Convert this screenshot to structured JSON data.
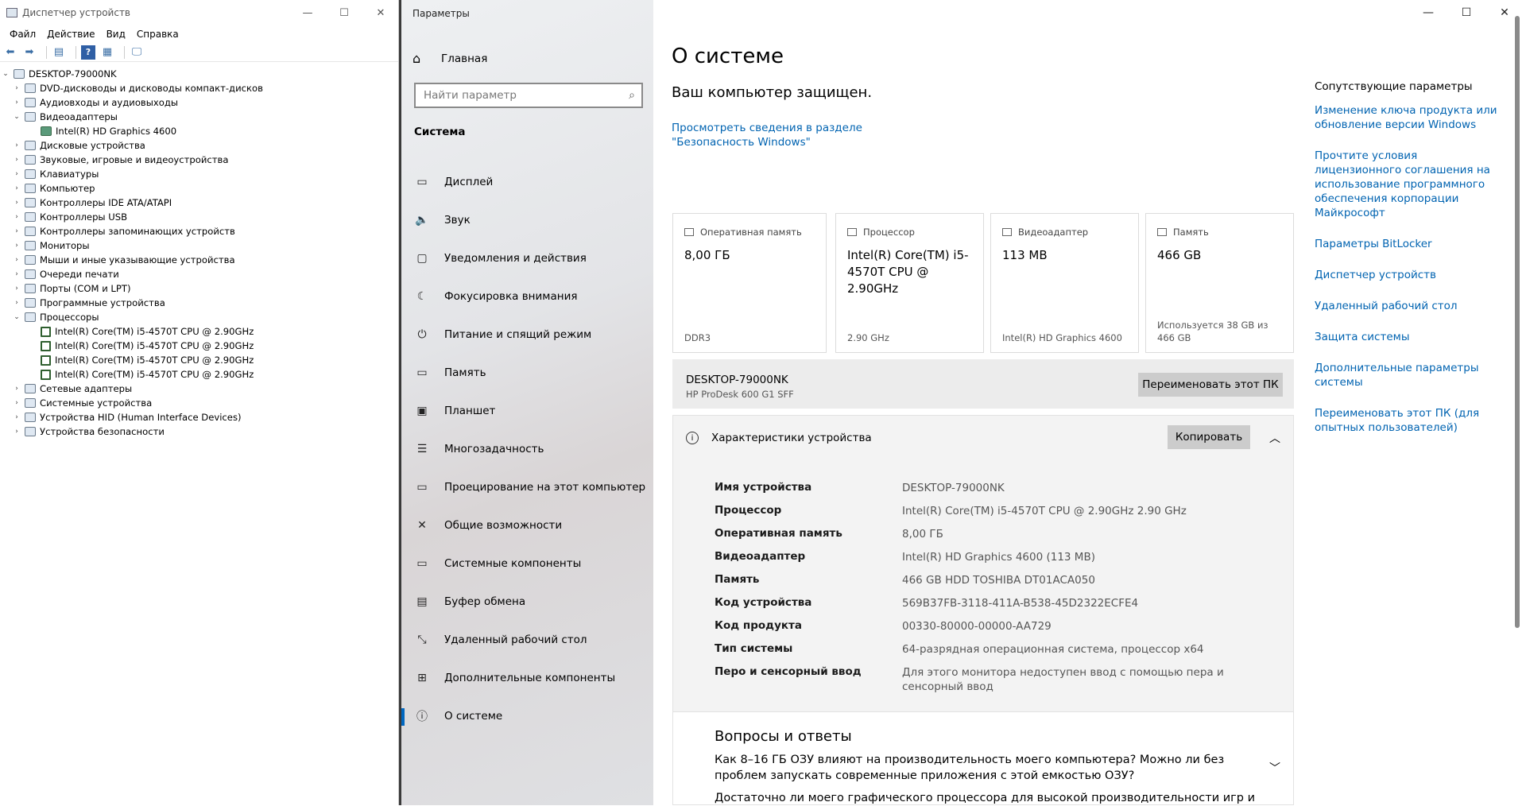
{
  "device_manager": {
    "title": "Диспетчер устройств",
    "menu": [
      "Файл",
      "Действие",
      "Вид",
      "Справка"
    ],
    "root": "DESKTOP-79000NK",
    "tree": [
      {
        "label": "DVD-дисководы и дисководы компакт-дисков",
        "level": 1,
        "expanded": false
      },
      {
        "label": "Аудиовходы и аудиовыходы",
        "level": 1,
        "expanded": false
      },
      {
        "label": "Видеоадаптеры",
        "level": 1,
        "expanded": true
      },
      {
        "label": "Intel(R) HD Graphics 4600",
        "level": 2,
        "icon": "gpu"
      },
      {
        "label": "Дисковые устройства",
        "level": 1,
        "expanded": false
      },
      {
        "label": "Звуковые, игровые и видеоустройства",
        "level": 1,
        "expanded": false
      },
      {
        "label": "Клавиатуры",
        "level": 1,
        "expanded": false
      },
      {
        "label": "Компьютер",
        "level": 1,
        "expanded": false
      },
      {
        "label": "Контроллеры IDE ATA/ATAPI",
        "level": 1,
        "expanded": false
      },
      {
        "label": "Контроллеры USB",
        "level": 1,
        "expanded": false
      },
      {
        "label": "Контроллеры запоминающих устройств",
        "level": 1,
        "expanded": false
      },
      {
        "label": "Мониторы",
        "level": 1,
        "expanded": false
      },
      {
        "label": "Мыши и иные указывающие устройства",
        "level": 1,
        "expanded": false
      },
      {
        "label": "Очереди печати",
        "level": 1,
        "expanded": false
      },
      {
        "label": "Порты (COM и LPT)",
        "level": 1,
        "expanded": false
      },
      {
        "label": "Программные устройства",
        "level": 1,
        "expanded": false
      },
      {
        "label": "Процессоры",
        "level": 1,
        "expanded": true
      },
      {
        "label": "Intel(R) Core(TM) i5-4570T CPU @ 2.90GHz",
        "level": 2,
        "icon": "cpu"
      },
      {
        "label": "Intel(R) Core(TM) i5-4570T CPU @ 2.90GHz",
        "level": 2,
        "icon": "cpu"
      },
      {
        "label": "Intel(R) Core(TM) i5-4570T CPU @ 2.90GHz",
        "level": 2,
        "icon": "cpu"
      },
      {
        "label": "Intel(R) Core(TM) i5-4570T CPU @ 2.90GHz",
        "level": 2,
        "icon": "cpu"
      },
      {
        "label": "Сетевые адаптеры",
        "level": 1,
        "expanded": false
      },
      {
        "label": "Системные устройства",
        "level": 1,
        "expanded": false
      },
      {
        "label": "Устройства HID (Human Interface Devices)",
        "level": 1,
        "expanded": false
      },
      {
        "label": "Устройства безопасности",
        "level": 1,
        "expanded": false
      }
    ]
  },
  "settings": {
    "app_title": "Параметры",
    "home": "Главная",
    "search_placeholder": "Найти параметр",
    "section": "Система",
    "nav": [
      {
        "label": "Дисплей",
        "icon": "display-icon",
        "glyph": "▭"
      },
      {
        "label": "Звук",
        "icon": "speaker-icon",
        "glyph": "🔈"
      },
      {
        "label": "Уведомления и действия",
        "icon": "notification-icon",
        "glyph": "▢"
      },
      {
        "label": "Фокусировка внимания",
        "icon": "moon-icon",
        "glyph": "☾"
      },
      {
        "label": "Питание и спящий режим",
        "icon": "power-icon",
        "glyph": "⏻"
      },
      {
        "label": "Память",
        "icon": "storage-icon",
        "glyph": "▭"
      },
      {
        "label": "Планшет",
        "icon": "tablet-icon",
        "glyph": "▣"
      },
      {
        "label": "Многозадачность",
        "icon": "multitask-icon",
        "glyph": "☰"
      },
      {
        "label": "Проецирование на этот компьютер",
        "icon": "project-icon",
        "glyph": "▭"
      },
      {
        "label": "Общие возможности",
        "icon": "share-icon",
        "glyph": "✕"
      },
      {
        "label": "Системные компоненты",
        "icon": "components-icon",
        "glyph": "▭"
      },
      {
        "label": "Буфер обмена",
        "icon": "clipboard-icon",
        "glyph": "▤"
      },
      {
        "label": "Удаленный рабочий стол",
        "icon": "remote-icon",
        "glyph": "⤡"
      },
      {
        "label": "Дополнительные компоненты",
        "icon": "optional-icon",
        "glyph": "⊞"
      },
      {
        "label": "О системе",
        "icon": "info-icon",
        "glyph": "ⓘ",
        "active": true
      }
    ],
    "content": {
      "title": "О системе",
      "protected": "Ваш компьютер защищен.",
      "security_link": "Просмотреть сведения в разделе \"Безопасность Windows\"",
      "cards": [
        {
          "label": "Оперативная память",
          "value": "8,00 ГБ",
          "sub": "DDR3"
        },
        {
          "label": "Процессор",
          "value": "Intel(R) Core(TM) i5-4570T CPU @ 2.90GHz",
          "sub": "2.90 GHz"
        },
        {
          "label": "Видеоадаптер",
          "value": "113 MB",
          "sub": "Intel(R) HD Graphics 4600"
        },
        {
          "label": "Память",
          "value": "466 GB",
          "sub": "Используется 38 GB из 466 GB"
        }
      ],
      "pc_name": "DESKTOP-79000NK",
      "pc_model": "HP ProDesk 600 G1 SFF",
      "rename_button": "Переименовать этот ПК",
      "spec_title": "Характеристики устройства",
      "copy_button": "Копировать",
      "specs": [
        {
          "k": "Имя устройства",
          "v": "DESKTOP-79000NK"
        },
        {
          "k": "Процессор",
          "v": "Intel(R) Core(TM) i5-4570T CPU @ 2.90GHz   2.90 GHz"
        },
        {
          "k": "Оперативная память",
          "v": "8,00 ГБ"
        },
        {
          "k": "Видеоадаптер",
          "v": "Intel(R) HD Graphics 4600 (113 MB)"
        },
        {
          "k": "Память",
          "v": "466 GB HDD TOSHIBA DT01ACA050"
        },
        {
          "k": "Код устройства",
          "v": "569B37FB-3118-411A-B538-45D2322ECFE4"
        },
        {
          "k": "Код продукта",
          "v": "00330-80000-00000-AA729"
        },
        {
          "k": "Тип системы",
          "v": "64-разрядная операционная система, процессор x64"
        },
        {
          "k": "Перо и сенсорный ввод",
          "v": "Для этого монитора недоступен ввод с помощью пера и сенсорный ввод"
        }
      ],
      "qa_title": "Вопросы и ответы",
      "qa_q1": "Как 8–16 ГБ ОЗУ влияют на производительность моего компьютера? Можно ли без проблем запускать современные приложения с этой емкостью ОЗУ?",
      "qa_q2": "Достаточно ли моего графического процессора для высокой производительности игр и"
    },
    "related": {
      "title": "Сопутствующие параметры",
      "links": [
        "Изменение ключа продукта или обновление версии Windows",
        "Прочтите условия лицензионного соглашения на использование программного обеспечения корпорации Майкрософт",
        "Параметры BitLocker",
        "Диспетчер устройств",
        "Удаленный рабочий стол",
        "Защита системы",
        "Дополнительные параметры системы",
        "Переименовать этот ПК (для опытных пользователей)"
      ]
    }
  }
}
